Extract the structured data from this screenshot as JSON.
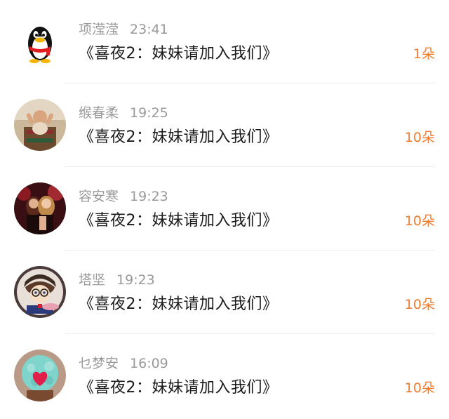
{
  "messages": [
    {
      "name": "项滢滢",
      "time": "23:41",
      "title": "《喜夜2：妹妹请加入我们》",
      "count": "1朵",
      "avatar_icon": "qq-penguin-avatar-icon"
    },
    {
      "name": "缑春柔",
      "time": "19:25",
      "title": "《喜夜2：妹妹请加入我们》",
      "count": "10朵",
      "avatar_icon": "baby-photo-avatar-icon"
    },
    {
      "name": "容安寒",
      "time": "19:23",
      "title": "《喜夜2：妹妹请加入我们》",
      "count": "10朵",
      "avatar_icon": "party-photo-avatar-icon"
    },
    {
      "name": "塔坚",
      "time": "19:23",
      "title": "《喜夜2：妹妹请加入我们》",
      "count": "10朵",
      "avatar_icon": "anime-detective-avatar-icon"
    },
    {
      "name": "乜梦安",
      "time": "16:09",
      "title": "《喜夜2：妹妹请加入我们》",
      "count": "10朵",
      "avatar_icon": "heart-cupcake-avatar-icon"
    }
  ],
  "colors": {
    "name_time": "#9a9a9a",
    "title": "#1a1a1a",
    "count_accent": "#f07a2c",
    "divider": "#eeeeee"
  }
}
